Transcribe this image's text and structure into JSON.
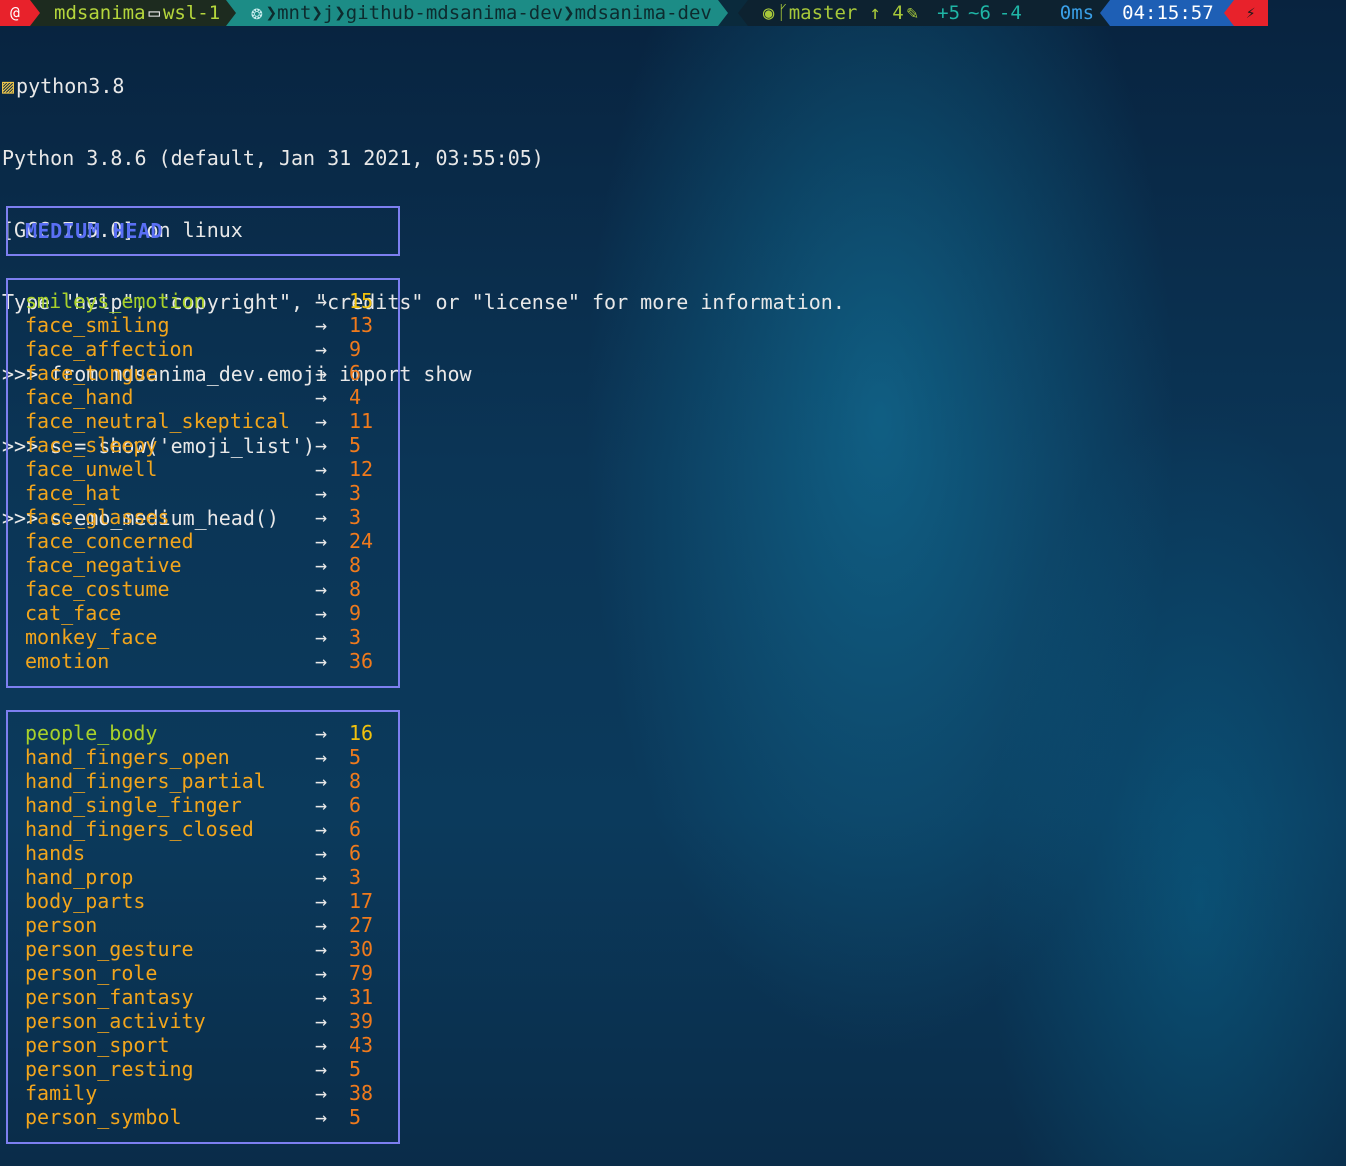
{
  "prompt": {
    "user": "mdsanima",
    "host": "wsl-1",
    "path_parts": [
      "mnt",
      "j",
      "github-mdsanima-dev",
      "mdsanima-dev"
    ],
    "git_branch": "master",
    "git_ahead": "↑ 4",
    "git_added": "+5",
    "git_modified": "~6",
    "git_deleted": "-4",
    "duration": "0ms",
    "time": "04:15:57",
    "icons": {
      "os": "debian-icon",
      "laptop": "laptop-icon",
      "folder": "folder-icon",
      "github": "github-icon",
      "branch": "git-branch-icon",
      "edit": "edit-icon",
      "plug": "plug-icon"
    },
    "colors": {
      "accent_red": "#e8222b",
      "path_teal": "#1c8c86",
      "time_blue": "#1e5fb5",
      "git_green": "#a7c83a"
    }
  },
  "terminal": {
    "venv": "python3.8",
    "lines": [
      "Python 3.8.6 (default, Jan 31 2021, 03:55:05)",
      "[GCC 7.5.0] on linux",
      "Type \"help\", \"copyright\", \"credits\" or \"license\" for more information.",
      ">>> from mdsanima_dev.emoji import show",
      ">>> s = show('emoji_list')",
      ">>> s.emo_medium_head()"
    ]
  },
  "header": {
    "title": "MEDIUM HEAD"
  },
  "arrow": "→",
  "groups": [
    {
      "rows": [
        {
          "name": "smileys_emotion",
          "count": "15"
        },
        {
          "name": "face_smiling",
          "count": "13"
        },
        {
          "name": "face_affection",
          "count": "9"
        },
        {
          "name": "face_tongue",
          "count": "6"
        },
        {
          "name": "face_hand",
          "count": "4"
        },
        {
          "name": "face_neutral_skeptical",
          "count": "11"
        },
        {
          "name": "face_sleepy",
          "count": "5"
        },
        {
          "name": "face_unwell",
          "count": "12"
        },
        {
          "name": "face_hat",
          "count": "3"
        },
        {
          "name": "face_glasses",
          "count": "3"
        },
        {
          "name": "face_concerned",
          "count": "24"
        },
        {
          "name": "face_negative",
          "count": "8"
        },
        {
          "name": "face_costume",
          "count": "8"
        },
        {
          "name": "cat_face",
          "count": "9"
        },
        {
          "name": "monkey_face",
          "count": "3"
        },
        {
          "name": "emotion",
          "count": "36"
        }
      ]
    },
    {
      "rows": [
        {
          "name": "people_body",
          "count": "16"
        },
        {
          "name": "hand_fingers_open",
          "count": "5"
        },
        {
          "name": "hand_fingers_partial",
          "count": "8"
        },
        {
          "name": "hand_single_finger",
          "count": "6"
        },
        {
          "name": "hand_fingers_closed",
          "count": "6"
        },
        {
          "name": "hands",
          "count": "6"
        },
        {
          "name": "hand_prop",
          "count": "3"
        },
        {
          "name": "body_parts",
          "count": "17"
        },
        {
          "name": "person",
          "count": "27"
        },
        {
          "name": "person_gesture",
          "count": "30"
        },
        {
          "name": "person_role",
          "count": "79"
        },
        {
          "name": "person_fantasy",
          "count": "31"
        },
        {
          "name": "person_activity",
          "count": "39"
        },
        {
          "name": "person_sport",
          "count": "43"
        },
        {
          "name": "person_resting",
          "count": "5"
        },
        {
          "name": "family",
          "count": "38"
        },
        {
          "name": "person_symbol",
          "count": "5"
        }
      ]
    }
  ]
}
